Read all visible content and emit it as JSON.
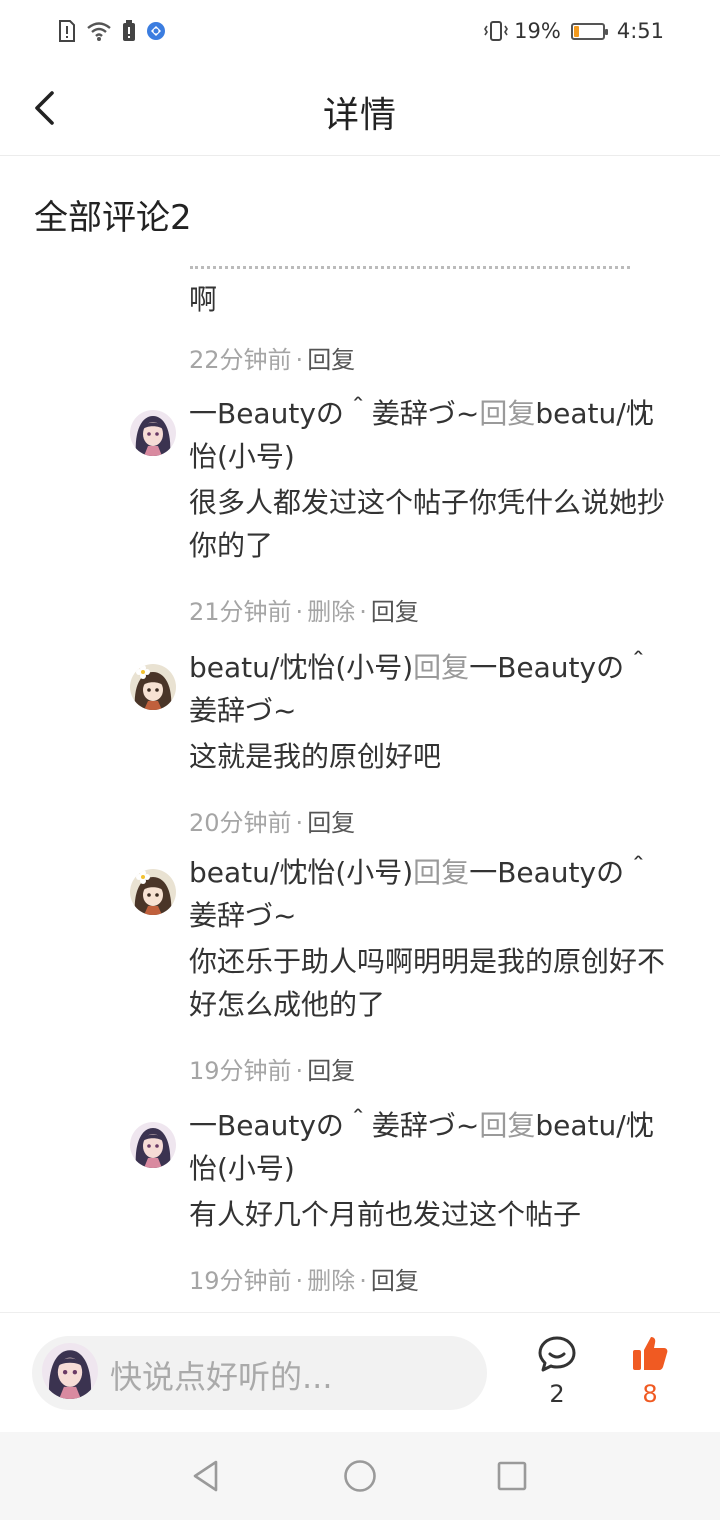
{
  "status_bar": {
    "battery_percent": "19%",
    "battery_level": 0.19,
    "time": "4:51",
    "icons": [
      "sim-alert-icon",
      "wifi-icon",
      "battery-alert-icon",
      "app-notification-icon",
      "vibrate-icon"
    ]
  },
  "header": {
    "title": "详情",
    "back_icon": "chevron-left-icon"
  },
  "comments_section": {
    "title": "全部评论2",
    "clipped_first_comment": {
      "text_tail": "啊",
      "time": "22分钟前",
      "reply_label": "回复"
    },
    "replies": [
      {
        "author": "一Beautyの＾姜辞づ~",
        "reply_word": "回复",
        "target": "beatu/忱怡(小号)",
        "text": "很多人都发过这个帖子你凭什么说她抄你的了",
        "time": "21分钟前",
        "delete_label": "删除",
        "reply_label": "回复",
        "avatar": "anime-girl-dark-hair"
      },
      {
        "author": "beatu/忱怡(小号)",
        "reply_word": "回复",
        "target": "一Beautyの＾姜辞づ~",
        "text": "这就是我的原创好吧",
        "time": "20分钟前",
        "reply_label": "回复",
        "avatar": "anime-girl-flower"
      },
      {
        "author": "beatu/忱怡(小号)",
        "reply_word": "回复",
        "target": "一Beautyの＾姜辞づ~",
        "text": "你还乐于助人吗啊明明是我的原创好不好怎么成他的了",
        "time": "19分钟前",
        "reply_label": "回复",
        "avatar": "anime-girl-flower"
      },
      {
        "author": "一Beautyの＾姜辞づ~",
        "reply_word": "回复",
        "target": "beatu/忱怡(小号)",
        "text": "有人好几个月前也发过这个帖子",
        "time": "19分钟前",
        "delete_label": "删除",
        "reply_label": "回复",
        "avatar": "anime-girl-dark-hair"
      }
    ]
  },
  "bottom_bar": {
    "placeholder": "快说点好听的...",
    "comment_count": "2",
    "like_count": "8",
    "like_color": "#f05a22"
  },
  "nav_bar": {
    "icons": [
      "nav-back-icon",
      "nav-home-icon",
      "nav-recents-icon"
    ]
  }
}
